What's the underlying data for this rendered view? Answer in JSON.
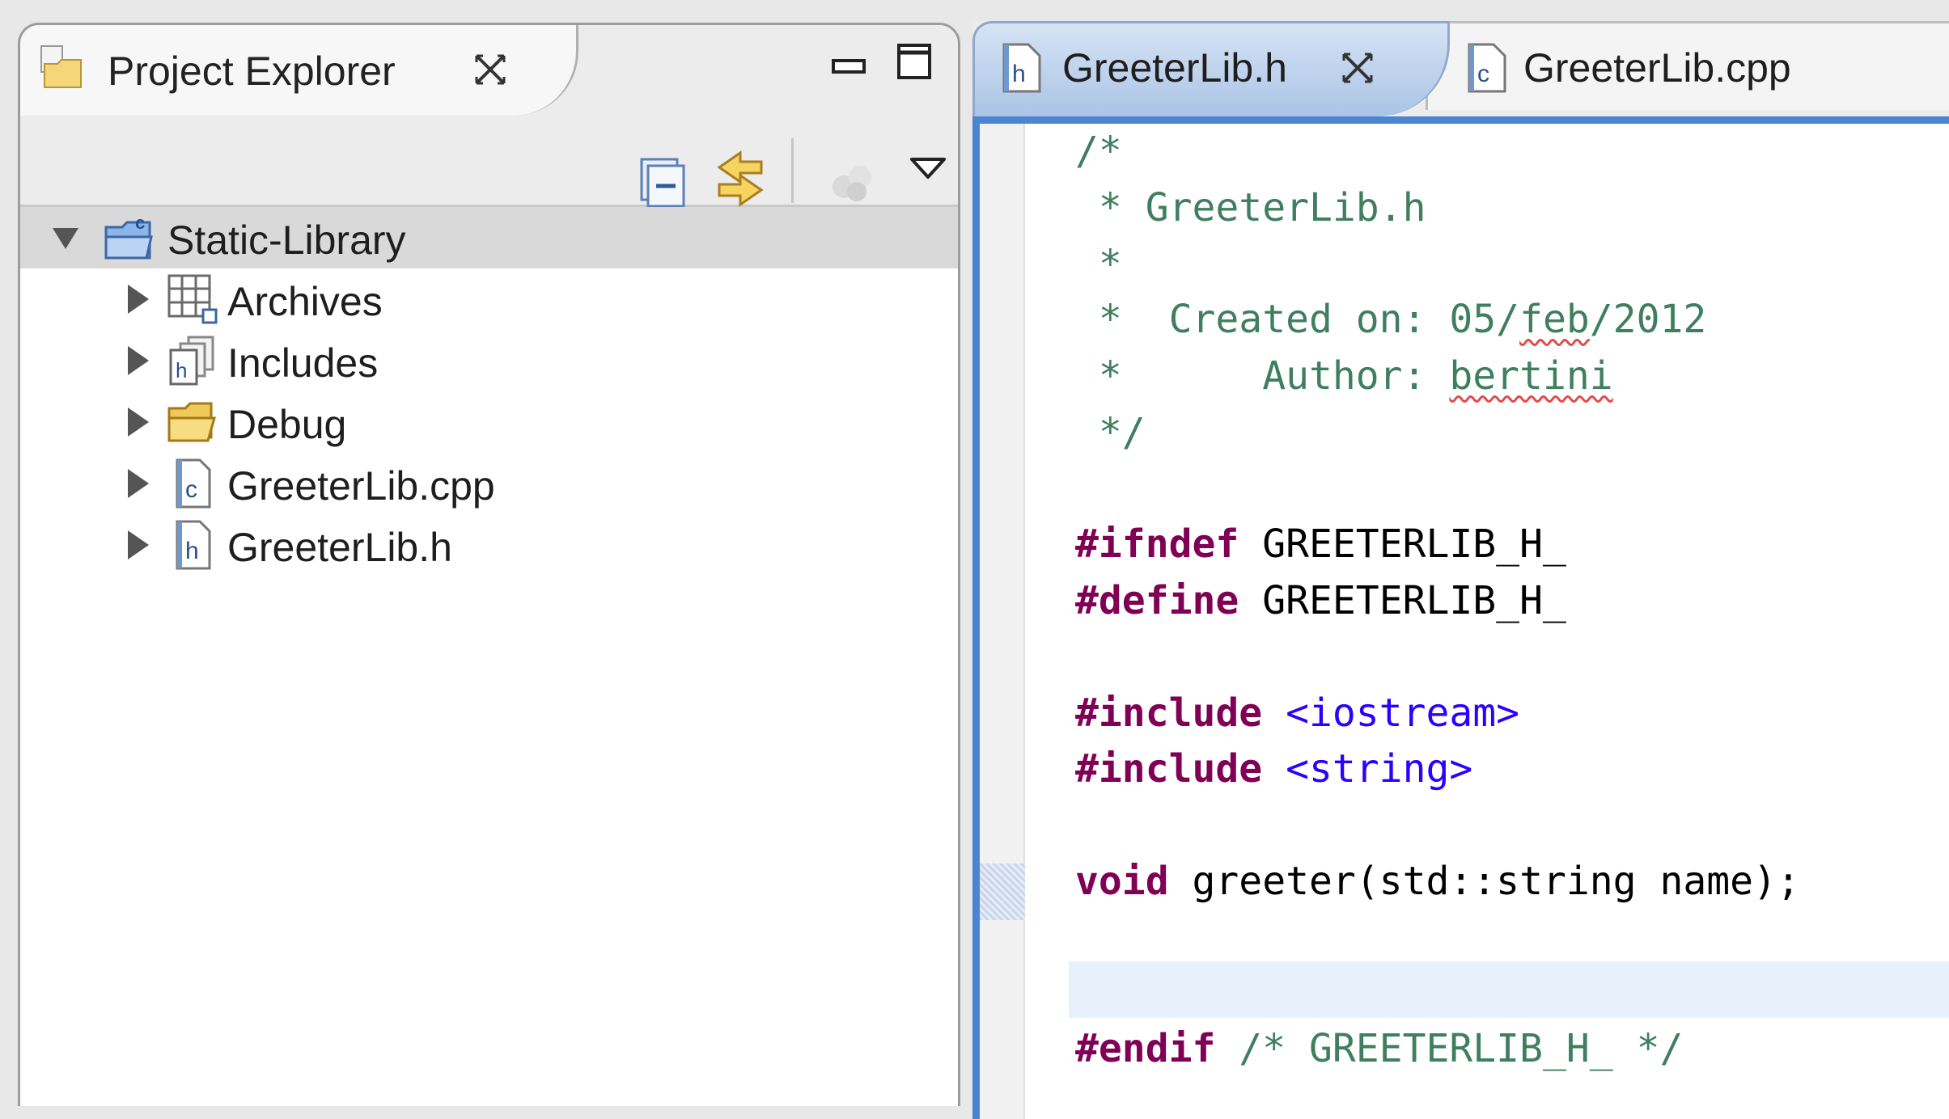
{
  "project_explorer": {
    "title": "Project Explorer",
    "tree": [
      {
        "label": "Static-Library",
        "expanded": true,
        "icon": "c-project-folder-icon"
      },
      {
        "label": "Archives",
        "icon": "archives-icon"
      },
      {
        "label": "Includes",
        "icon": "includes-icon"
      },
      {
        "label": "Debug",
        "icon": "folder-icon"
      },
      {
        "label": "GreeterLib.cpp",
        "icon": "cpp-file-icon"
      },
      {
        "label": "GreeterLib.h",
        "icon": "header-file-icon"
      }
    ]
  },
  "editor": {
    "tabs": [
      {
        "label": "GreeterLib.h",
        "active": true
      },
      {
        "label": "GreeterLib.cpp",
        "active": false
      }
    ],
    "code": {
      "l1": "/*",
      "l2": " * GreeterLib.h",
      "l3": " *",
      "l4a": " *  Created on: 05/",
      "l4b": "feb",
      "l4c": "/2012",
      "l5a": " *      Author: ",
      "l5b": "bertini",
      "l6": " */",
      "ifndef_kw": "#ifndef",
      "ifndef_id": " GREETERLIB_H_",
      "define_kw": "#define",
      "define_id": " GREETERLIB_H_",
      "inc1_kw": "#include",
      "inc1_str": " <iostream>",
      "inc2_kw": "#include",
      "inc2_str": " <string>",
      "void_kw": "void",
      "decl": " greeter(std::string name);",
      "endif_kw": "#endif",
      "endif_cmt": " /* GREETERLIB_H_ */"
    }
  },
  "colors": {
    "keyword": "#7f0055",
    "comment": "#3f7f5f",
    "string": "#2a00ff",
    "active_border": "#4b84d1"
  }
}
